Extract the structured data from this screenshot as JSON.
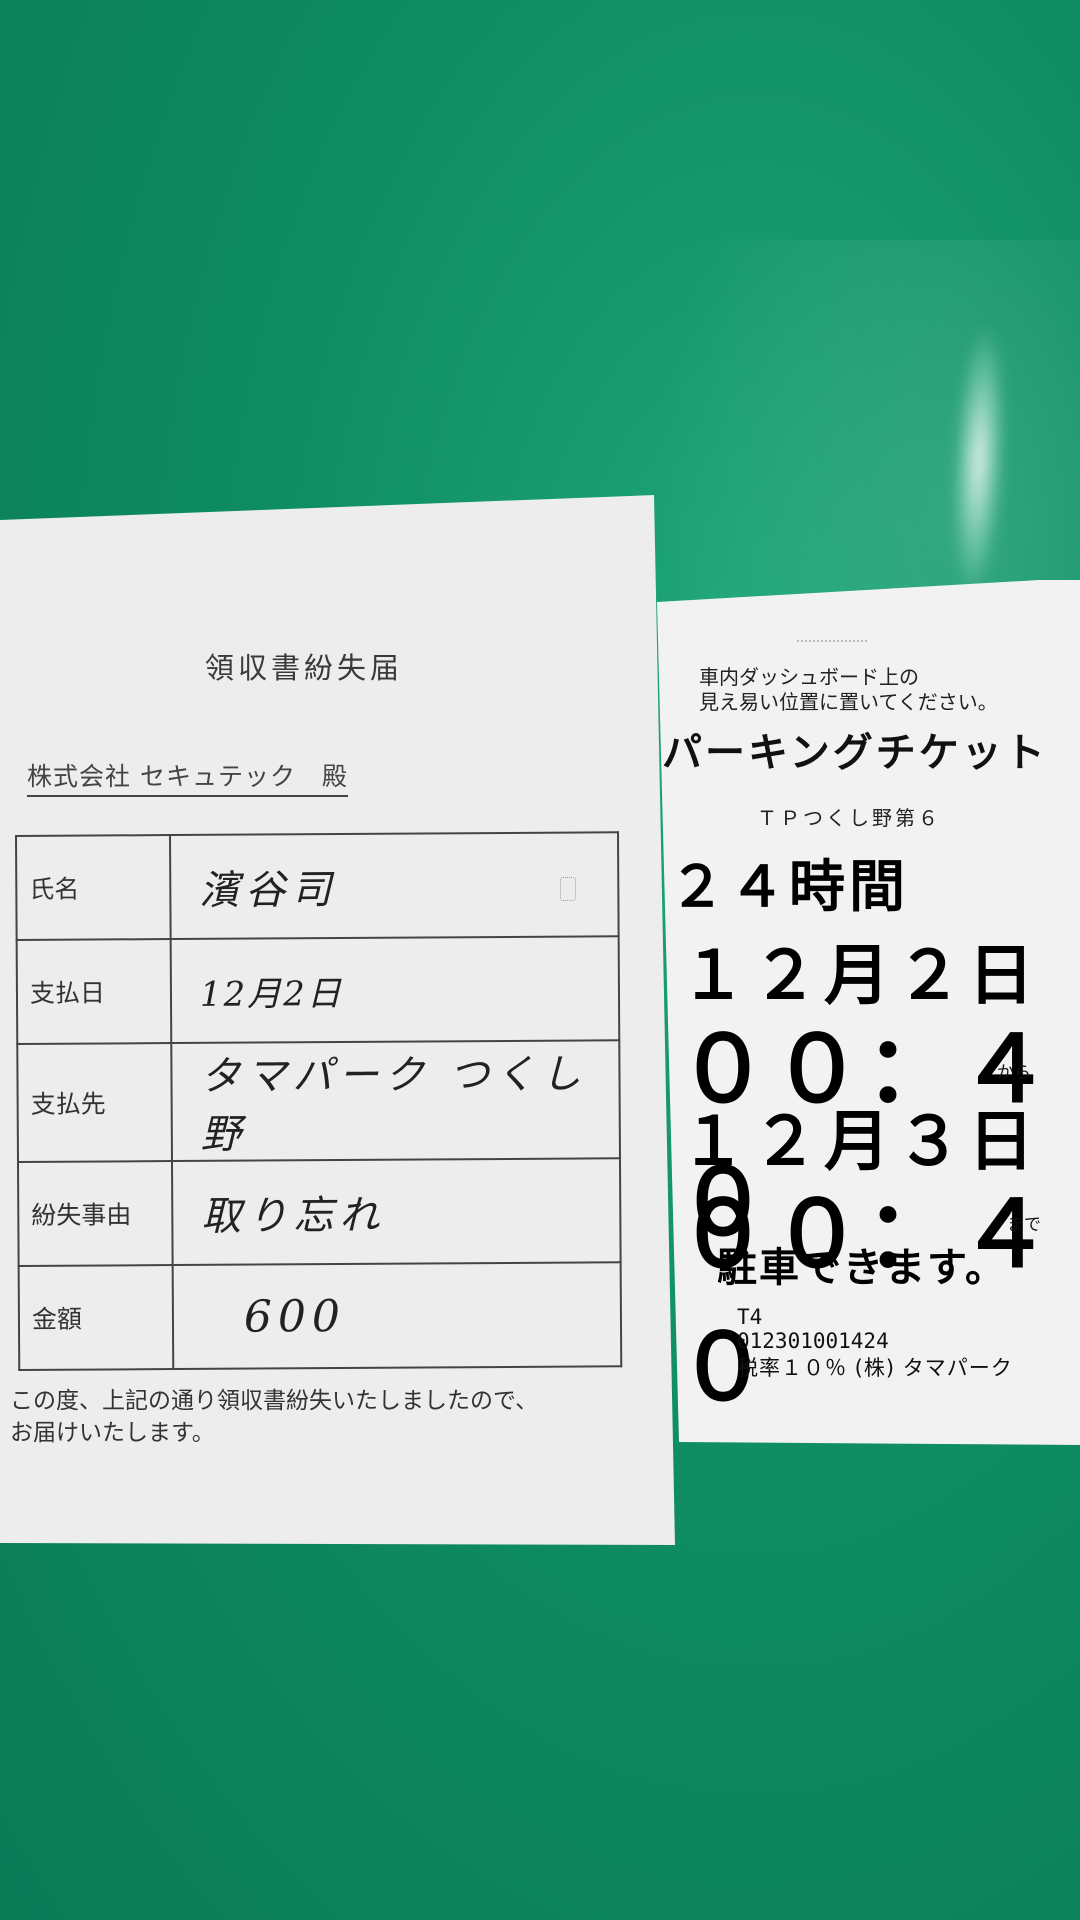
{
  "form": {
    "title": "領収書紛失届",
    "addressee": "株式会社 セキュテック　殿",
    "rows": [
      {
        "label": "氏名",
        "value": "濱谷司"
      },
      {
        "label": "支払日",
        "value": "12月2日"
      },
      {
        "label": "支払先",
        "value": "タマパーク つくし野"
      },
      {
        "label": "紛失事由",
        "value": "取り忘れ"
      },
      {
        "label": "金額",
        "value": "600"
      }
    ],
    "note_line1": "この度、上記の通り領収書紛失いたしましたので、",
    "note_line2": "お届けいたします。"
  },
  "ticket": {
    "instruction_line1": "車内ダッシュボード上の",
    "instruction_line2": "見え易い位置に置いてください。",
    "title": "パーキングチケット",
    "lot": "ＴＰつくし野第６",
    "duration": "２４時間",
    "from_date": "１２月２日",
    "from_time": "００：４０",
    "from_suffix": "から",
    "to_date": "１２月３日",
    "to_time": "００：４０",
    "to_suffix": "まで",
    "parking_ok": "駐車できます。",
    "terminal": "T4",
    "code": "012301001424",
    "tax_line": "税率１０％ (株) タマパーク"
  }
}
